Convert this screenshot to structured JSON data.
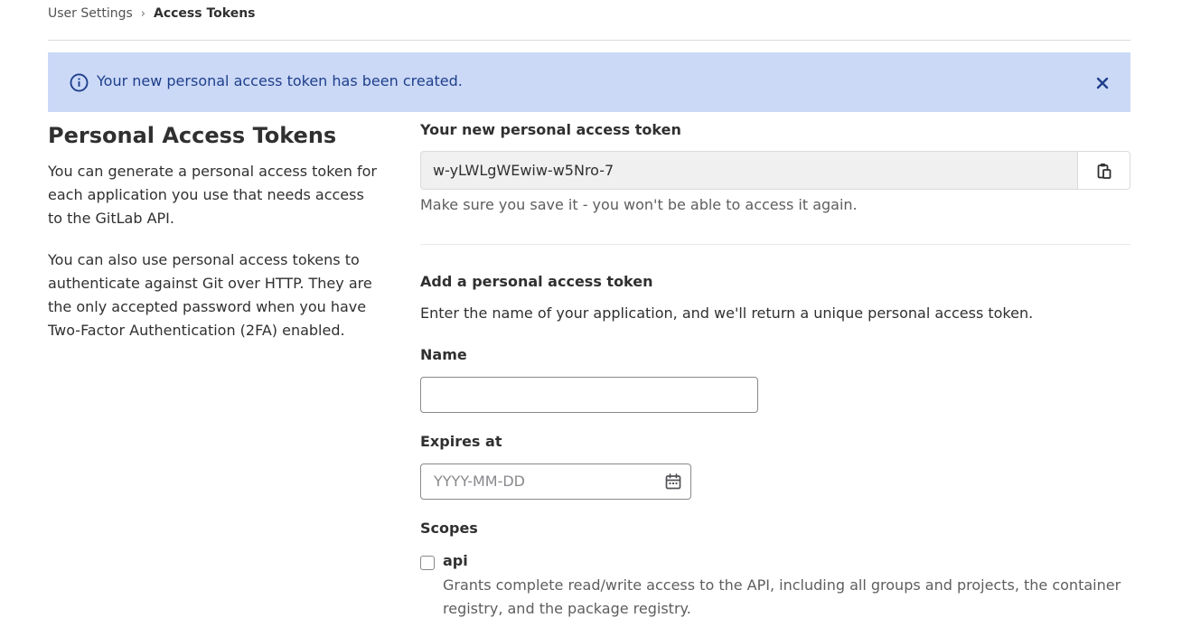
{
  "breadcrumb": {
    "parent": "User Settings",
    "separator": "›",
    "current": "Access Tokens"
  },
  "alert": {
    "message": "Your new personal access token has been created.",
    "icon": "info-icon",
    "close_icon": "close-icon",
    "background": "#cbd9f7",
    "text_color": "#1f3f8b"
  },
  "intro": {
    "title": "Personal Access Tokens",
    "paragraph1": "You can generate a personal access token for each application you use that needs access to the GitLab API.",
    "paragraph2": "You can also use personal access tokens to authenticate against Git over HTTP. They are the only accepted password when you have Two-Factor Authentication (2FA) enabled."
  },
  "new_token": {
    "label": "Your new personal access token",
    "value": "w-yLWLgWEwiw-w5Nro-7",
    "copy_icon": "clipboard-icon",
    "help": "Make sure you save it - you won't be able to access it again."
  },
  "add_token": {
    "heading": "Add a personal access token",
    "description": "Enter the name of your application, and we'll return a unique personal access token.",
    "name_label": "Name",
    "name_value": "",
    "expires_label": "Expires at",
    "expires_placeholder": "YYYY-MM-DD",
    "calendar_icon": "calendar-icon",
    "scopes_label": "Scopes",
    "scopes": [
      {
        "name": "api",
        "checked": false,
        "description": "Grants complete read/write access to the API, including all groups and projects, the container registry, and the package registry."
      }
    ]
  }
}
